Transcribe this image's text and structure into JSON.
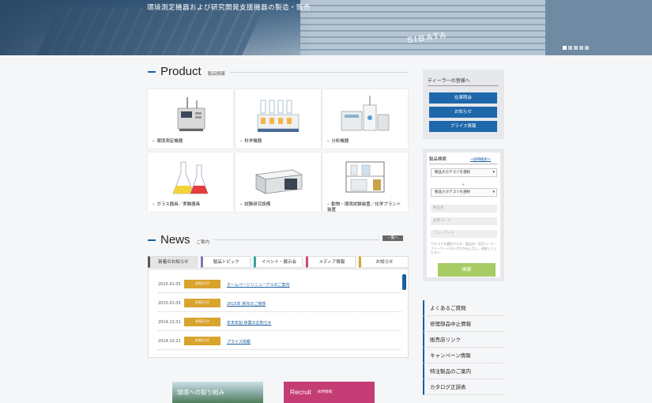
{
  "hero": {
    "tagline": "環境測定機器および研究開発支援機器の製造・販売",
    "brand": "SIBATA",
    "slider_dots": 5,
    "active_dot": 1
  },
  "product": {
    "title": "Product",
    "subtitle": "製品情報",
    "items": [
      {
        "label": "環境測定機器",
        "icon": "environment-analyzer"
      },
      {
        "label": "科学機器",
        "icon": "lab-apparatus"
      },
      {
        "label": "分析機器",
        "icon": "analysis-system"
      },
      {
        "label": "ガラス器具／実験器具",
        "icon": "glass-flasks"
      },
      {
        "label": "試験研究設備",
        "icon": "lab-bench"
      },
      {
        "label": "動物・環境試験装置／化学プラント装置",
        "icon": "plant-equipment"
      }
    ]
  },
  "news": {
    "title": "News",
    "subtitle": "ご案内",
    "more_label": "一覧へ",
    "tabs": [
      "新着のお知らせ",
      "製品トピック",
      "イベント・展示会",
      "メディア情報",
      "お知らせ"
    ],
    "rows": [
      {
        "date": "2015.01.05",
        "badge": "お知らせ",
        "text": "ホームページリニューアルのご案内"
      },
      {
        "date": "2015.01.05",
        "badge": "お知らせ",
        "text": "2015年 新年のご挨拶"
      },
      {
        "date": "2014.12.01",
        "badge": "お知らせ",
        "text": "年末年始 休業のお知らせ"
      },
      {
        "date": "2014.10.21",
        "badge": "お知らせ",
        "text": "プライス情報"
      }
    ]
  },
  "banners": {
    "environment": "環境への取り組み",
    "recruit": "Recruit",
    "recruit_sub": "採用情報"
  },
  "dealer": {
    "heading": "ディーラーの皆様へ",
    "buttons": [
      "在庫照会",
      "お知らせ",
      "プライス情報"
    ]
  },
  "search": {
    "heading": "製品検索",
    "detail_link": "→詳細検索へ",
    "major_category": "製品大カテゴリを選択",
    "minor_category": "製品小カテゴリを選択",
    "plus": "+",
    "name_placeholder": "製品名",
    "code_placeholder": "品目コード",
    "free_placeholder": "フリーワード",
    "note": "カテゴリを選択するか、製品名／品目コード／フリーワードのいずれかを入力し、検索してください",
    "submit": "検索"
  },
  "links": [
    "よくあるご質問",
    "修理部品中止情報",
    "販売店リンク",
    "キャンペーン情報",
    "特注製品のご案内",
    "カタログ正誤表"
  ]
}
